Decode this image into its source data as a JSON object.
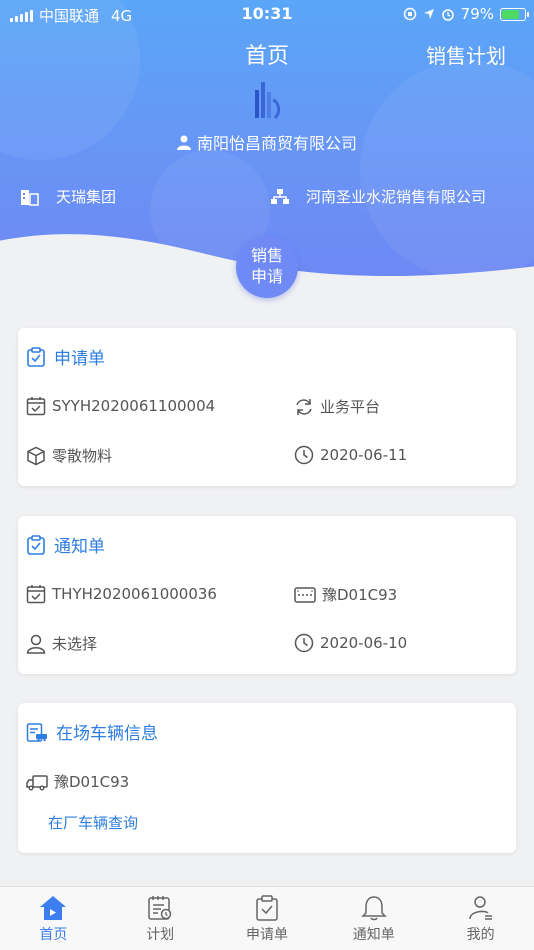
{
  "status": {
    "carrier": "中国联通",
    "network": "4G",
    "time": "10:31",
    "battery": "79%",
    "battery_level": 0.79
  },
  "header": {
    "title": "首页",
    "plan_link": "销售计划",
    "company": "南阳怡昌商贸有限公司",
    "group_left": "天瑞集团",
    "group_right": "河南圣业水泥销售有限公司",
    "sale_button_line1": "销售",
    "sale_button_line2": "申请"
  },
  "application_card": {
    "title": "申请单",
    "order_no": "SYYH2020061100004",
    "platform": "业务平台",
    "material": "零散物料",
    "date": "2020-06-11"
  },
  "notice_card": {
    "title": "通知单",
    "order_no": "THYH2020061000036",
    "plate": "豫D01C93",
    "person": "未选择",
    "date": "2020-06-10"
  },
  "vehicle_card": {
    "title": "在场车辆信息",
    "plate": "豫D01C93",
    "link": "在厂车辆查询"
  },
  "tabs": [
    {
      "label": "首页",
      "icon": "home-icon"
    },
    {
      "label": "计划",
      "icon": "plan-icon"
    },
    {
      "label": "申请单",
      "icon": "clipboard-icon"
    },
    {
      "label": "通知单",
      "icon": "bell-icon"
    },
    {
      "label": "我的",
      "icon": "profile-icon"
    }
  ],
  "colors": {
    "accent": "#2e7de0",
    "header_gradient_top": "#5aa6f8",
    "header_gradient_bottom": "#6e86f3",
    "active_tab": "#3d7ef0"
  }
}
